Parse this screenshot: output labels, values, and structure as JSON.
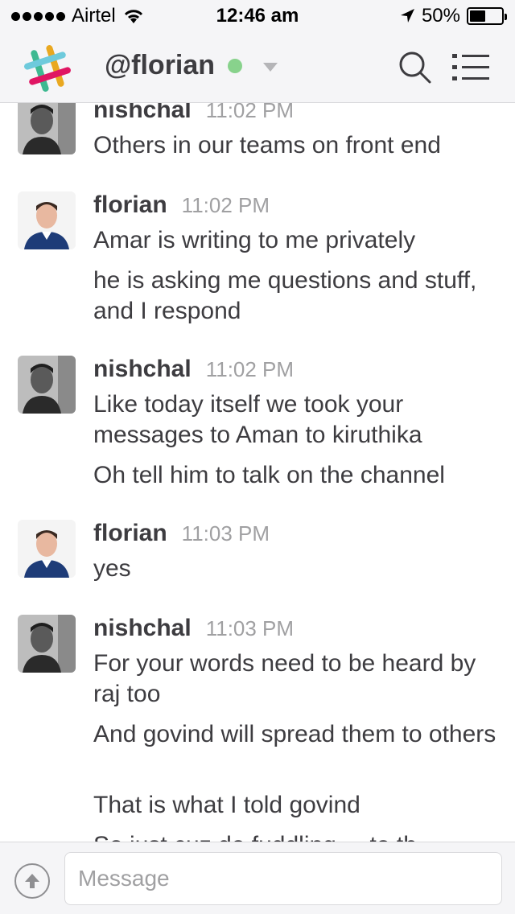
{
  "status_bar": {
    "carrier": "Airtel",
    "time": "12:46 am",
    "battery": "50%",
    "battery_level": 0.5
  },
  "header": {
    "channel_name": "@florian",
    "presence_color": "#88d28c"
  },
  "messages": [
    {
      "author": "nishchal",
      "time": "11:02 PM",
      "lines": [
        "Others in our teams on front end"
      ]
    },
    {
      "author": "florian",
      "time": "11:02 PM",
      "lines": [
        "Amar is writing to me privately",
        "he is asking me questions and stuff, and I respond"
      ]
    },
    {
      "author": "nishchal",
      "time": "11:02 PM",
      "lines": [
        "Like today itself we took your messages to Aman to kiruthika",
        "Oh tell him to talk on the channel"
      ]
    },
    {
      "author": "florian",
      "time": "11:03 PM",
      "lines": [
        "yes"
      ]
    },
    {
      "author": "nishchal",
      "time": "11:03 PM",
      "lines": [
        "For your words need to be heard by raj too",
        "And govind will spread them to others",
        "That is what I told govind",
        "So just cuz de fuddling ... to th..."
      ]
    }
  ],
  "composer": {
    "placeholder": "Message"
  },
  "colors": {
    "text": "#3d3c40",
    "muted": "#a0a0a2",
    "bar_bg": "#f5f5f7"
  }
}
